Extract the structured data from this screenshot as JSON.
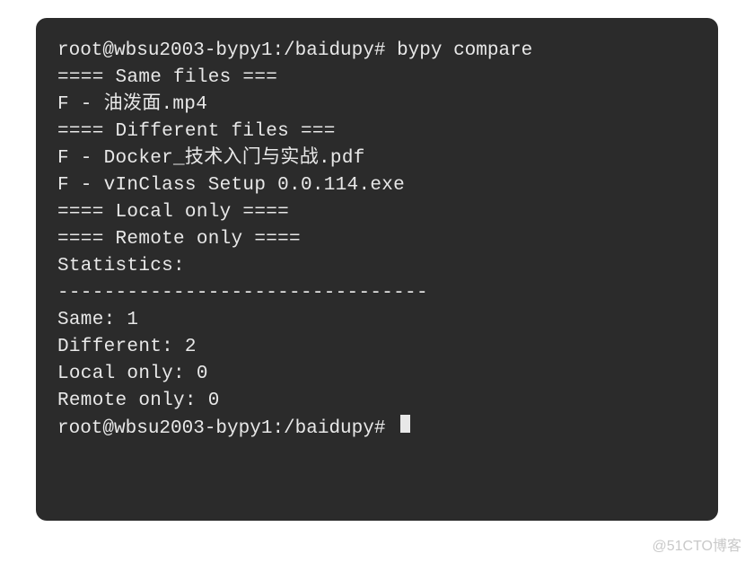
{
  "terminal": {
    "prompt1": "root@wbsu2003-bypy1:/baidupy# ",
    "command1": "bypy compare",
    "lines": [
      "==== Same files ===",
      "F - 油泼面.mp4",
      "==== Different files ===",
      "F - Docker_技术入门与实战.pdf",
      "F - vInClass Setup 0.0.114.exe",
      "==== Local only ====",
      "==== Remote only ====",
      "",
      "Statistics:",
      "--------------------------------",
      "Same: 1",
      "Different: 2",
      "Local only: 0",
      "Remote only: 0"
    ],
    "prompt2": "root@wbsu2003-bypy1:/baidupy# "
  },
  "watermark": "@51CTO博客"
}
